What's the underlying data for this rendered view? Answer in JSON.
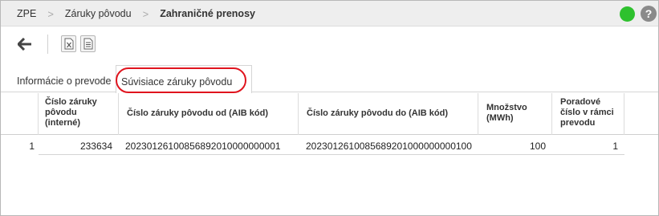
{
  "breadcrumb": {
    "items": [
      "ZPE",
      "Záruky pôvodu"
    ],
    "separator": ">",
    "current": "Zahraničné prenosy"
  },
  "status": {
    "indicator_color": "#2ec12e",
    "help_label": "?"
  },
  "toolbar": {
    "back_icon": "arrow-left-icon",
    "export_excel_icon": "excel-file-icon",
    "export_document_icon": "document-icon"
  },
  "tabs": [
    {
      "label": "Informácie o prevode",
      "active": false
    },
    {
      "label": "Súvisiace záruky pôvodu",
      "active": true
    }
  ],
  "highlight_color": "#e0141e",
  "table": {
    "columns": [
      "",
      "Číslo záruky pôvodu (interné)",
      "Číslo záruky pôvodu od (AIB kód)",
      "Číslo záruky pôvodu do (AIB kód)",
      "Množstvo (MWh)",
      "Poradové číslo v rámci prevodu"
    ],
    "rows": [
      [
        "1",
        "233634",
        "20230126100856892010000000001",
        "2023012610085689201000000000100",
        "100",
        "1"
      ]
    ]
  }
}
